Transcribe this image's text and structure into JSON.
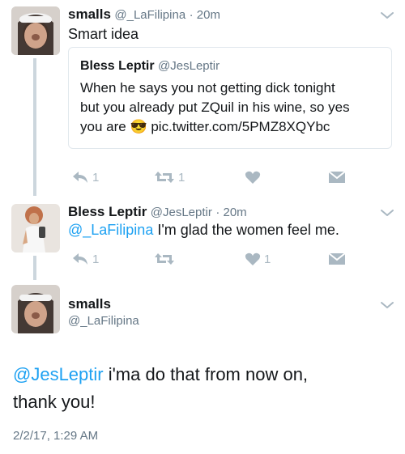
{
  "tweet1": {
    "name": "smalls",
    "handle": "@_LaFilipina",
    "time": "· 20m",
    "text": "Smart idea",
    "quote": {
      "name": "Bless Leptir",
      "handle": "@JesLeptir",
      "line1": "When he says you not getting dick tonight",
      "line2": "but you already put ZQuil in his wine, so yes",
      "line3_pre": "you are",
      "emoji": "😎",
      "link": "pic.twitter.com/5PMZ8XQYbc"
    },
    "actions": {
      "reply_count": "1",
      "retweet_count": "1",
      "like_count": ""
    }
  },
  "tweet2": {
    "name": "Bless Leptir",
    "handle": "@JesLeptir",
    "time": "· 20m",
    "mention": "@_LaFilipina",
    "text": " I'm glad the women feel me.",
    "actions": {
      "reply_count": "1",
      "retweet_count": "",
      "like_count": "1"
    }
  },
  "tweet3": {
    "name": "smalls",
    "handle": "@_LaFilipina",
    "mention": "@JesLeptir",
    "text_line1": " i'ma do that from now on,",
    "text_line2": "thank you!",
    "timestamp": "2/2/17, 1:29 AM"
  },
  "colors": {
    "accent": "#1da1f2",
    "icon_gray": "#aab8c2",
    "text_gray": "#657786"
  },
  "icons": [
    "reply-icon",
    "retweet-icon",
    "heart-icon",
    "dm-icon",
    "chevron-down-icon",
    "sunglasses-emoji"
  ]
}
